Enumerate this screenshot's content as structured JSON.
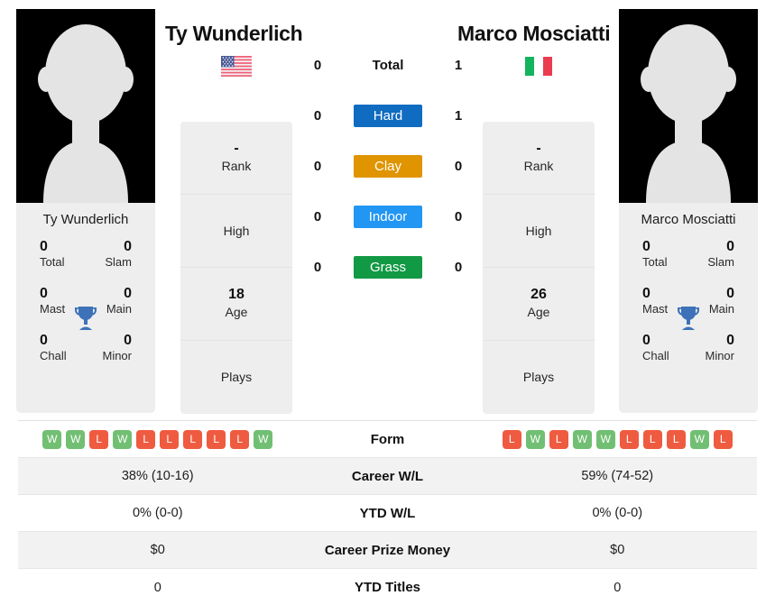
{
  "players": {
    "left": {
      "name": "Ty Wunderlich",
      "flag": "us-flag-icon",
      "rank": "-",
      "rank_label": "Rank",
      "high": "",
      "high_label": "High",
      "age": "18",
      "age_label": "Age",
      "plays": "",
      "plays_label": "Plays",
      "titles": {
        "total": "0",
        "total_label": "Total",
        "slam": "0",
        "slam_label": "Slam",
        "mast": "0",
        "mast_label": "Mast",
        "main": "0",
        "main_label": "Main",
        "chall": "0",
        "chall_label": "Chall",
        "minor": "0",
        "minor_label": "Minor"
      },
      "form": [
        "W",
        "W",
        "L",
        "W",
        "L",
        "L",
        "L",
        "L",
        "L",
        "W"
      ],
      "career_wl": "38% (10-16)",
      "ytd_wl": "0% (0-0)",
      "career_prize": "$0",
      "ytd_titles": "0"
    },
    "right": {
      "name": "Marco Mosciatti",
      "flag": "it-flag-icon",
      "rank": "-",
      "rank_label": "Rank",
      "high": "",
      "high_label": "High",
      "age": "26",
      "age_label": "Age",
      "plays": "",
      "plays_label": "Plays",
      "titles": {
        "total": "0",
        "total_label": "Total",
        "slam": "0",
        "slam_label": "Slam",
        "mast": "0",
        "mast_label": "Mast",
        "main": "0",
        "main_label": "Main",
        "chall": "0",
        "chall_label": "Chall",
        "minor": "0",
        "minor_label": "Minor"
      },
      "form": [
        "L",
        "W",
        "L",
        "W",
        "W",
        "L",
        "L",
        "L",
        "W",
        "L"
      ],
      "career_wl": "59% (74-52)",
      "ytd_wl": "0% (0-0)",
      "career_prize": "$0",
      "ytd_titles": "0"
    }
  },
  "surfaces": [
    {
      "label": "Total",
      "left": "0",
      "right": "1",
      "badge": false,
      "color": ""
    },
    {
      "label": "Hard",
      "left": "0",
      "right": "1",
      "badge": true,
      "color": "#0f6cc0"
    },
    {
      "label": "Clay",
      "left": "0",
      "right": "0",
      "badge": true,
      "color": "#e09400"
    },
    {
      "label": "Indoor",
      "left": "0",
      "right": "0",
      "badge": true,
      "color": "#2196f3"
    },
    {
      "label": "Grass",
      "left": "0",
      "right": "0",
      "badge": true,
      "color": "#119944"
    }
  ],
  "stat_rows": [
    {
      "label": "Form",
      "type": "form"
    },
    {
      "label": "Career W/L",
      "type": "text",
      "key": "career_wl"
    },
    {
      "label": "YTD W/L",
      "type": "text",
      "key": "ytd_wl"
    },
    {
      "label": "Career Prize Money",
      "type": "text",
      "key": "career_prize"
    },
    {
      "label": "YTD Titles",
      "type": "text",
      "key": "ytd_titles"
    }
  ],
  "colors": {
    "win": "#71bf73",
    "loss": "#ef5b40",
    "card_bg": "#eeeeee",
    "row_shade": "#f2f2f2",
    "trophy": "#3d72b8"
  }
}
